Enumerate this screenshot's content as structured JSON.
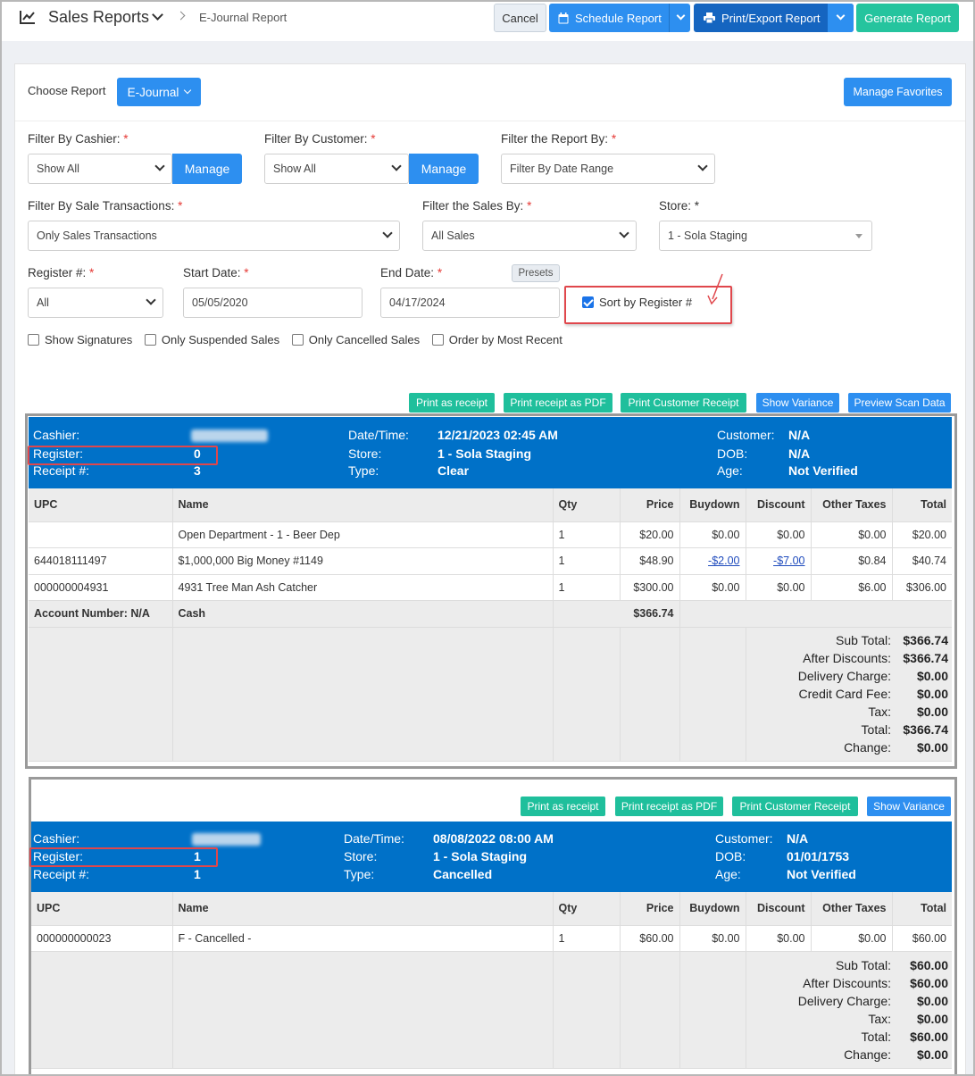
{
  "header": {
    "title": "Sales Reports",
    "breadcrumb": "E-Journal Report",
    "cancel": "Cancel",
    "schedule": "Schedule Report",
    "print_export": "Print/Export Report",
    "generate": "Generate Report"
  },
  "choose": {
    "label": "Choose Report",
    "report": "E-Journal",
    "manage_favorites": "Manage Favorites"
  },
  "filters": {
    "cashier": {
      "label": "Filter By Cashier:",
      "value": "Show All",
      "manage": "Manage"
    },
    "customer": {
      "label": "Filter By Customer:",
      "value": "Show All",
      "manage": "Manage"
    },
    "report_by": {
      "label": "Filter the Report By:",
      "value": "Filter By Date Range"
    },
    "sale_transactions": {
      "label": "Filter By Sale Transactions:",
      "value": "Only Sales Transactions"
    },
    "sales_by": {
      "label": "Filter the Sales By:",
      "value": "All Sales"
    },
    "store": {
      "label": "Store: *",
      "value": "1 - Sola Staging"
    },
    "register": {
      "label": "Register #:",
      "value": "All"
    },
    "start_date": {
      "label": "Start Date:",
      "value": "05/05/2020"
    },
    "end_date": {
      "label": "End Date:",
      "value": "04/17/2024"
    },
    "presets": "Presets",
    "sort_register": "Sort by Register #",
    "required_mark": "*",
    "checks": [
      "Show Signatures",
      "Only Suspended Sales",
      "Only Cancelled Sales",
      "Order by Most Recent"
    ]
  },
  "actions": [
    "Print as receipt",
    "Print receipt as PDF",
    "Print Customer Receipt",
    "Show Variance",
    "Preview Scan Data"
  ],
  "actions2": [
    "Print as receipt",
    "Print receipt as PDF",
    "Print Customer Receipt",
    "Show Variance"
  ],
  "labels": {
    "cashier": "Cashier:",
    "register": "Register:",
    "receipt": "Receipt #:",
    "datetime": "Date/Time:",
    "store": "Store:",
    "type": "Type:",
    "customer": "Customer:",
    "dob": "DOB:",
    "age": "Age:"
  },
  "columns": [
    "UPC",
    "Name",
    "Qty",
    "Price",
    "Buydown",
    "Discount",
    "Other Taxes",
    "Total"
  ],
  "totals_labels": [
    "Sub Total:",
    "After Discounts:",
    "Delivery Charge:",
    "Credit Card Fee:",
    "Tax:",
    "Total:",
    "Change:"
  ],
  "receipt1": {
    "register": "0",
    "receipt": "3",
    "datetime": "12/21/2023 02:45 AM",
    "store": "1 - Sola Staging",
    "type": "Clear",
    "customer": "N/A",
    "dob": "N/A",
    "age": "Not Verified",
    "items": [
      {
        "upc": "",
        "name": "Open Department - 1 - Beer Dep",
        "qty": "1",
        "price": "$20.00",
        "buydown": "$0.00",
        "discount": "$0.00",
        "other": "$0.00",
        "total": "$20.00"
      },
      {
        "upc": "644018111497",
        "name": "$1,000,000 Big Money #1149",
        "qty": "1",
        "price": "$48.90",
        "buydown": "-$2.00",
        "discount": "-$7.00",
        "other": "$0.84",
        "total": "$40.74"
      },
      {
        "upc": "000000004931",
        "name": "4931 Tree Man Ash Catcher",
        "qty": "1",
        "price": "$300.00",
        "buydown": "$0.00",
        "discount": "$0.00",
        "other": "$6.00",
        "total": "$306.00"
      }
    ],
    "account": "Account Number: N/A",
    "tender": "Cash",
    "tender_amount": "$366.74",
    "totals": [
      "$366.74",
      "$366.74",
      "$0.00",
      "$0.00",
      "$0.00",
      "$366.74",
      "$0.00"
    ]
  },
  "receipt2": {
    "register": "1",
    "receipt": "1",
    "datetime": "08/08/2022 08:00 AM",
    "store": "1 - Sola Staging",
    "type": "Cancelled",
    "customer": "N/A",
    "dob": "01/01/1753",
    "age": "Not Verified",
    "items": [
      {
        "upc": "000000000023",
        "name": "F - Cancelled -",
        "qty": "1",
        "price": "$60.00",
        "buydown": "$0.00",
        "discount": "$0.00",
        "other": "$0.00",
        "total": "$60.00"
      }
    ],
    "totals_labels": [
      "Sub Total:",
      "After Discounts:",
      "Delivery Charge:",
      "Tax:",
      "Total:",
      "Change:"
    ],
    "totals": [
      "$60.00",
      "$60.00",
      "$0.00",
      "$0.00",
      "$60.00",
      "$0.00"
    ]
  },
  "colors": {
    "accent": "#2d8ff0",
    "header_blue": "#0071c8",
    "teal": "#1fbf9c",
    "highlight": "#e0474c"
  }
}
